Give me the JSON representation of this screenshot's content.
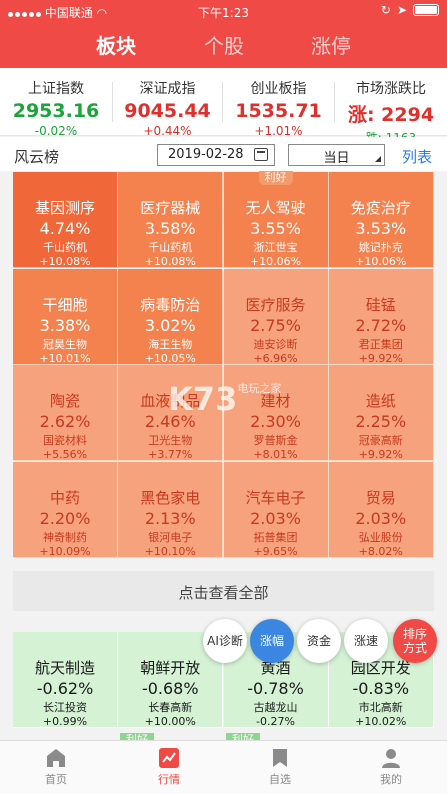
{
  "status_bar": {
    "carrier": "中国联通",
    "time": "下午1:23"
  },
  "tabs": [
    {
      "label": "板块",
      "active": true
    },
    {
      "label": "个股",
      "active": false
    },
    {
      "label": "涨停",
      "active": false
    }
  ],
  "indices": [
    {
      "name": "上证指数",
      "value": "2953.16",
      "change": "-0.02%",
      "dir": "down"
    },
    {
      "name": "深证成指",
      "value": "9045.44",
      "change": "+0.44%",
      "dir": "up"
    },
    {
      "name": "创业板指",
      "value": "1535.71",
      "change": "+1.01%",
      "dir": "up"
    }
  ],
  "market_breadth": {
    "name": "市场涨跌比",
    "up_label": "涨:",
    "up_value": "2294",
    "down_label": "跌:",
    "down_value": "1163"
  },
  "fengyun": {
    "title": "风云榜",
    "date": "2019-02-28",
    "period": "当日",
    "list_link": "列表"
  },
  "sectors": [
    {
      "name": "基因测序",
      "pct": "4.74%",
      "stock": "千山药机",
      "stock_chg": "+10.08%",
      "color": "#f0683a",
      "badge": ""
    },
    {
      "name": "医疗器械",
      "pct": "3.58%",
      "stock": "千山药机",
      "stock_chg": "+10.08%",
      "color": "#f4824f",
      "badge": ""
    },
    {
      "name": "无人驾驶",
      "pct": "3.55%",
      "stock": "浙江世宝",
      "stock_chg": "+10.06%",
      "color": "#f4824f",
      "badge": "利好"
    },
    {
      "name": "免疫治疗",
      "pct": "3.53%",
      "stock": "姚记扑克",
      "stock_chg": "+10.06%",
      "color": "#f4824f",
      "badge": ""
    },
    {
      "name": "干细胞",
      "pct": "3.38%",
      "stock": "冠昊生物",
      "stock_chg": "+10.01%",
      "color": "#f4824f",
      "badge": ""
    },
    {
      "name": "病毒防治",
      "pct": "3.02%",
      "stock": "海王生物",
      "stock_chg": "+10.05%",
      "color": "#f4824f",
      "badge": ""
    },
    {
      "name": "医疗服务",
      "pct": "2.75%",
      "stock": "迪安诊断",
      "stock_chg": "+6.96%",
      "color": "#f6a27c",
      "badge": ""
    },
    {
      "name": "硅锰",
      "pct": "2.72%",
      "stock": "君正集团",
      "stock_chg": "+9.92%",
      "color": "#f6a27c",
      "badge": ""
    },
    {
      "name": "陶瓷",
      "pct": "2.62%",
      "stock": "国瓷材料",
      "stock_chg": "+5.56%",
      "color": "#f6a27c",
      "badge": ""
    },
    {
      "name": "血液制品",
      "pct": "2.46%",
      "stock": "卫光生物",
      "stock_chg": "+3.77%",
      "color": "#f6a27c",
      "badge": ""
    },
    {
      "name": "建材",
      "pct": "2.30%",
      "stock": "罗普斯金",
      "stock_chg": "+8.01%",
      "color": "#f6a27c",
      "badge": ""
    },
    {
      "name": "造纸",
      "pct": "2.25%",
      "stock": "冠豪高新",
      "stock_chg": "+9.92%",
      "color": "#f6a27c",
      "badge": ""
    },
    {
      "name": "中药",
      "pct": "2.20%",
      "stock": "神奇制药",
      "stock_chg": "+10.09%",
      "color": "#f6a27c",
      "badge": ""
    },
    {
      "name": "黑色家电",
      "pct": "2.13%",
      "stock": "银河电子",
      "stock_chg": "+10.10%",
      "color": "#f6a27c",
      "badge": ""
    },
    {
      "name": "汽车电子",
      "pct": "2.03%",
      "stock": "拓普集团",
      "stock_chg": "+9.65%",
      "color": "#f6a27c",
      "badge": ""
    },
    {
      "name": "贸易",
      "pct": "2.03%",
      "stock": "弘业股份",
      "stock_chg": "+8.02%",
      "color": "#f6a27c",
      "badge": ""
    }
  ],
  "view_all_label": "点击查看全部",
  "losers": [
    {
      "name": "航天制造",
      "pct": "-0.62%",
      "stock": "长江投资",
      "stock_chg": "+0.99%",
      "color": "#d5f2d5"
    },
    {
      "name": "朝鲜开放",
      "pct": "-0.68%",
      "stock": "长春高新",
      "stock_chg": "+10.00%",
      "color": "#d5f2d5"
    },
    {
      "name": "黄酒",
      "pct": "-0.78%",
      "stock": "古越龙山",
      "stock_chg": "-0.27%",
      "color": "#d5f2d5"
    },
    {
      "name": "园区开发",
      "pct": "-0.83%",
      "stock": "市北高新",
      "stock_chg": "+10.02%",
      "color": "#d5f2d5"
    }
  ],
  "loser_badges": [
    "利好",
    "利好"
  ],
  "float_buttons": [
    {
      "label": "AI诊断",
      "active": false
    },
    {
      "label": "涨幅",
      "active": true
    },
    {
      "label": "资金",
      "active": false
    },
    {
      "label": "涨速",
      "active": false
    }
  ],
  "sort_button": {
    "line1": "排序",
    "line2": "方式"
  },
  "watermark": {
    "logo": "K73",
    "site": "电玩之家"
  },
  "bottom_nav": [
    {
      "label": "首页",
      "icon": "home-icon",
      "active": false
    },
    {
      "label": "行情",
      "icon": "chart-icon",
      "active": true
    },
    {
      "label": "自选",
      "icon": "bookmark-icon",
      "active": false
    },
    {
      "label": "我的",
      "icon": "user-icon",
      "active": false
    }
  ]
}
